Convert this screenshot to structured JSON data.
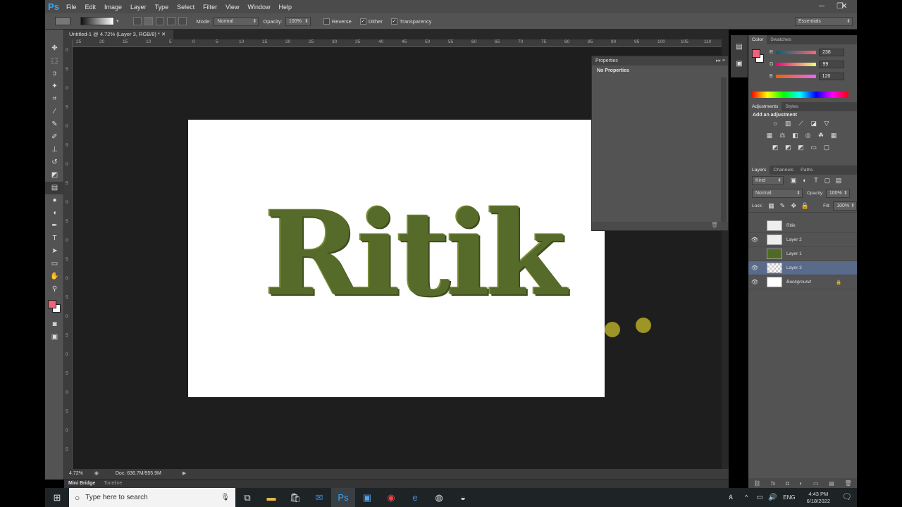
{
  "app": {
    "logo": "Ps"
  },
  "menu": [
    "File",
    "Edit",
    "Image",
    "Layer",
    "Type",
    "Select",
    "Filter",
    "View",
    "Window",
    "Help"
  ],
  "window_controls": {
    "minimize": "─",
    "restore": "❐",
    "close": "✕"
  },
  "options": {
    "mode_label": "Mode:",
    "mode_value": "Normal",
    "opacity_label": "Opacity:",
    "opacity_value": "100%",
    "reverse": "Reverse",
    "dither": "Dither",
    "transparency": "Transparency",
    "workspace": "Essentials",
    "dither_checked": true,
    "transparency_checked": true
  },
  "document": {
    "tab_title": "Untitled-1 @ 4.72% (Layer 3, RGB/8) *",
    "text": "Ritik",
    "ruler_h": [
      "25",
      "20",
      "15",
      "10",
      "5",
      "0",
      "5",
      "10",
      "15",
      "20",
      "25",
      "30",
      "35",
      "40",
      "45",
      "50",
      "55",
      "60",
      "65",
      "70",
      "75",
      "80",
      "85",
      "90",
      "95",
      "100",
      "105",
      "110",
      "115"
    ],
    "ruler_v": [
      "0",
      "5",
      "0",
      "5",
      "0",
      "5",
      "0",
      "5",
      "0",
      "5",
      "0",
      "5",
      "0",
      "5",
      "0",
      "5",
      "0",
      "5",
      "0",
      "5",
      "0",
      "5"
    ]
  },
  "properties": {
    "title": "Properties",
    "subtitle": "No Properties"
  },
  "status": {
    "zoom": "4.72%",
    "doc": "Doc: 636.7M/955.9M"
  },
  "bottom_tabs": {
    "mini_bridge": "Mini Bridge",
    "timeline": "Timeline"
  },
  "color_panel": {
    "tabs": [
      "Color",
      "Swatches"
    ],
    "r_label": "R",
    "r_value": "238",
    "g_label": "G",
    "g_value": "99",
    "b_label": "B",
    "b_value": "120",
    "fg_color": "#ee6378"
  },
  "adjustments": {
    "tabs": [
      "Adjustments",
      "Styles"
    ],
    "heading": "Add an adjustment"
  },
  "layers_panel": {
    "tabs": [
      "Layers",
      "Channels",
      "Paths"
    ],
    "kind": "Kind",
    "blend": "Normal",
    "opacity_label": "Opacity:",
    "opacity_value": "100%",
    "lock_label": "Lock:",
    "fill_label": "Fill:",
    "fill_value": "100%",
    "layers": [
      {
        "name": "Ritik",
        "visible": false
      },
      {
        "name": "Layer 2",
        "visible": true
      },
      {
        "name": "Layer 1",
        "visible": false
      },
      {
        "name": "Layer 3",
        "visible": true,
        "selected": true
      },
      {
        "name": "Background",
        "visible": true,
        "locked": true
      }
    ]
  },
  "taskbar": {
    "search_placeholder": "Type here to search",
    "time": "4:43 PM",
    "date": "6/18/2022",
    "lang": "ENG"
  }
}
